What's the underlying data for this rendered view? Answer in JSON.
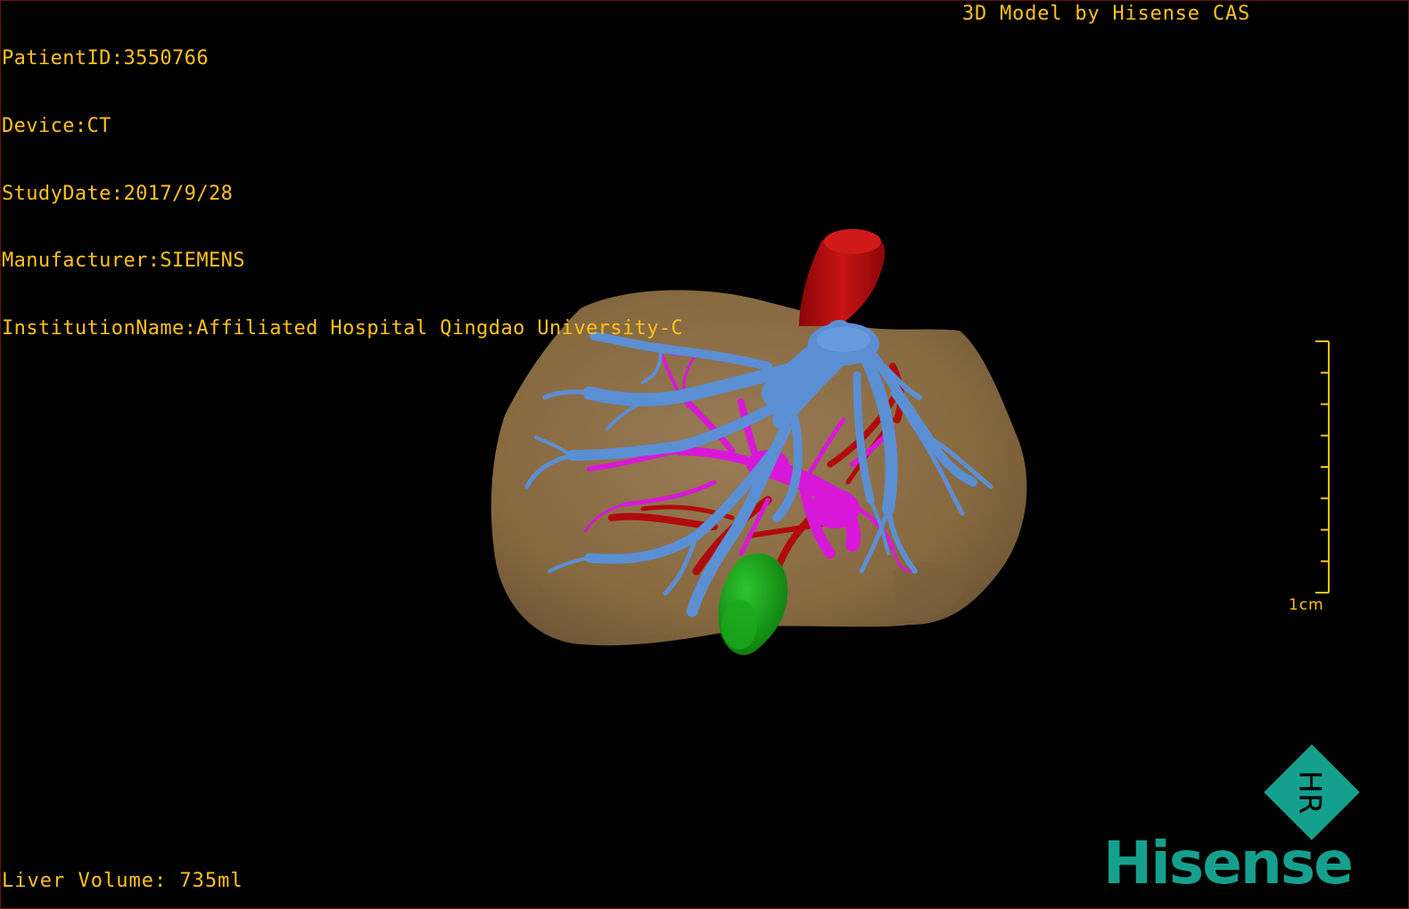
{
  "overlay": {
    "info_lines": [
      "PatientID:3550766",
      "Device:CT",
      "StudyDate:2017/9/28",
      "Manufacturer:SIEMENS",
      "InstitutionName:Affiliated Hospital Qingdao University-C"
    ],
    "credit": "3D Model by Hisense CAS",
    "volume": "Liver Volume: 735ml"
  },
  "scale_bar": {
    "label": "1cm",
    "ticks": 9
  },
  "logo": {
    "brand": "Hisense",
    "mark_text": "HR",
    "color": "#15a08e"
  },
  "model": {
    "structures": [
      {
        "name": "liver",
        "color": "#8b6e4c"
      },
      {
        "name": "hepatic-vein",
        "color": "#5b8fd4"
      },
      {
        "name": "portal-vein",
        "color": "#d818d8"
      },
      {
        "name": "artery-ivc",
        "color": "#b00b0b"
      },
      {
        "name": "lesion",
        "color": "#129a12"
      }
    ]
  },
  "colors": {
    "text": "#ffc21a",
    "background": "#000000",
    "frame": "#6b1010"
  }
}
